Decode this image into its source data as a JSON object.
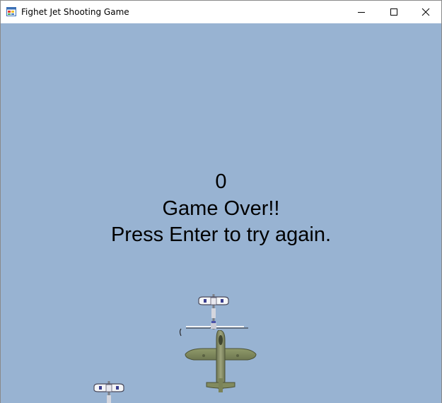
{
  "window": {
    "title": "Fighet Jet Shooting Game",
    "controls": {
      "minimize_icon": "minimize-icon",
      "maximize_icon": "maximize-icon",
      "close_icon": "close-icon"
    }
  },
  "game": {
    "background_color": "#98b3d2",
    "score": "0",
    "game_over_text": "Game Over!!",
    "retry_text": "Press Enter to try again.",
    "sprites": {
      "player": "green-fighter-jet-icon",
      "enemy": "white-enemy-plane-icon"
    }
  }
}
